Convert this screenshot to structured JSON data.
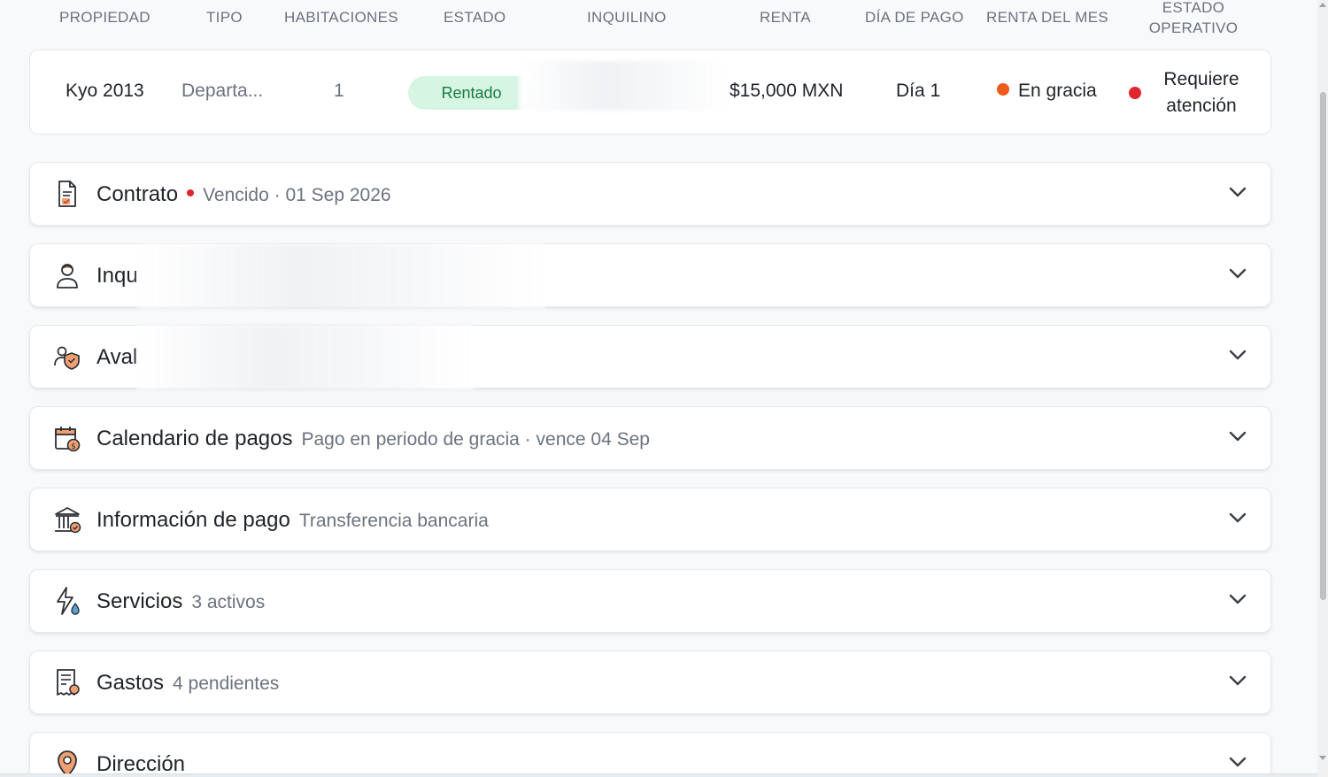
{
  "table_header": {
    "propiedad": "PROPIEDAD",
    "tipo": "TIPO",
    "habitaciones": "HABITACIONES",
    "estado": "ESTADO",
    "inquilino": "INQUILINO",
    "renta": "RENTA",
    "dia_pago": "DÍA DE PAGO",
    "renta_mes": "RENTA DEL MES",
    "estado_operativo": "ESTADO OPERATIVO"
  },
  "property_row": {
    "propiedad": "Kyo 2013",
    "tipo": "Departa...",
    "habitaciones": "1",
    "estado": "Rentado",
    "renta": "$15,000 MXN",
    "dia_pago": "Día 1",
    "renta_mes": "En gracia",
    "estado_operativo": "Requiere atención"
  },
  "sections": {
    "contrato": {
      "title": "Contrato",
      "subtitle": "Vencido · 01 Sep 2026"
    },
    "inquilino": {
      "title": "Inqu"
    },
    "aval": {
      "title": "Aval"
    },
    "calendario": {
      "title": "Calendario de pagos",
      "subtitle": "Pago en periodo de gracia · vence 04 Sep"
    },
    "informacion_pago": {
      "title": "Información de pago",
      "subtitle": "Transferencia bancaria"
    },
    "servicios": {
      "title": "Servicios",
      "subtitle": "3 activos"
    },
    "gastos": {
      "title": "Gastos",
      "subtitle": "4 pendientes"
    },
    "direccion": {
      "title": "Dirección"
    }
  },
  "colors": {
    "badge_bg": "#d6f5e3",
    "badge_text": "#1a7a45",
    "grace_dot": "#f05a1a",
    "alert_dot": "#e0252f",
    "icon_accent": "#f0a070"
  }
}
